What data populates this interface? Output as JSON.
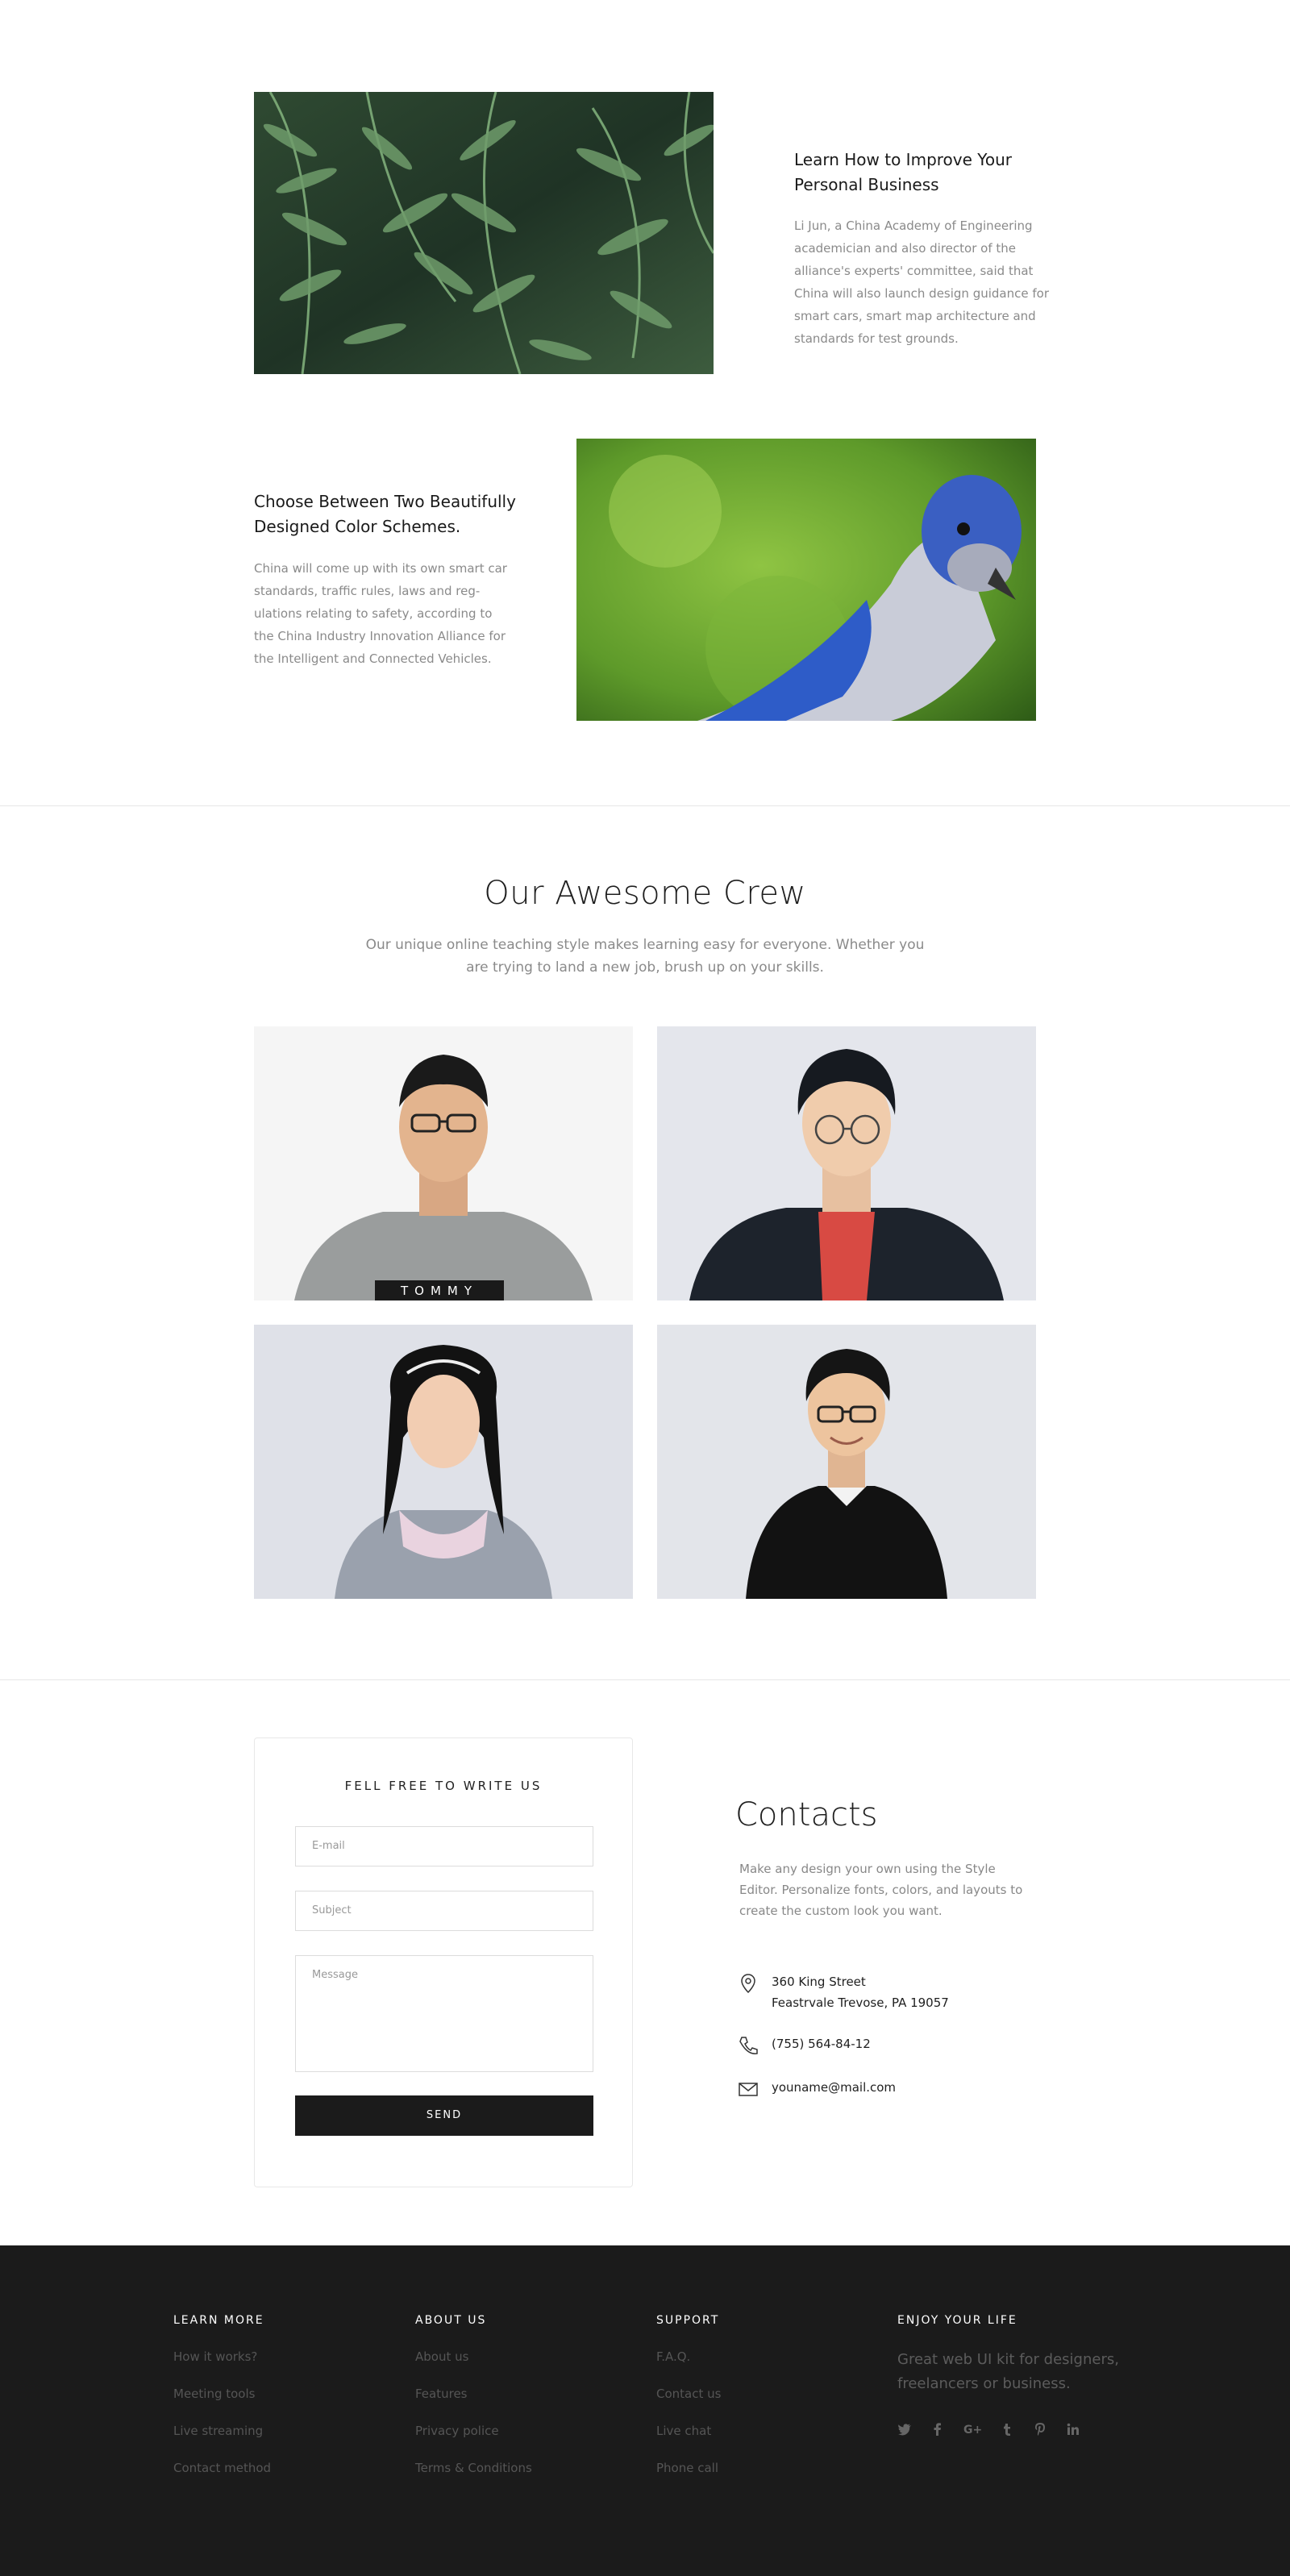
{
  "features": [
    {
      "title": "Learn How to Improve Your Personal Business",
      "text": "Li Jun, a China Academy of Engineering academician and also director of the alliance's experts' committee, said that China will also launch design guidance for smart cars, smart map architecture and standards for test grounds.",
      "image": "fern-leaves-photo"
    },
    {
      "title": "Choose Between Two Beautifully Designed Color Schemes.",
      "text": "China will come up with its own smart car standards, traffic rules, laws and reg-ulations relating to safety, according to the China Industry Innovation Alliance for the Intelligent and Connected Vehicles.",
      "image": "blue-bird-photo"
    }
  ],
  "crew": {
    "title": "Our Awesome Crew",
    "subtitle": "Our unique online teaching style makes learning easy for everyone. Whether you are trying to land a new job, brush up on your skills.",
    "members": [
      {
        "photo": "man-grey-sweater-photo",
        "shirt_text": "TOMMY"
      },
      {
        "photo": "man-black-jacket-photo"
      },
      {
        "photo": "woman-pink-sweater-photo"
      },
      {
        "photo": "man-black-sweater-photo"
      }
    ]
  },
  "form": {
    "title": "FELL FREE TO WRITE US",
    "email_placeholder": "E-mail",
    "subject_placeholder": "Subject",
    "message_placeholder": "Message",
    "send_label": "SEND"
  },
  "contacts": {
    "title": "Contacts",
    "text": "Make any design your own using the Style Editor. Personalize fonts, colors, and layouts to create the custom look you want.",
    "address_line1": "360 King Street",
    "address_line2": "Feastrvale Trevose, PA 19057",
    "phone": "(755) 564-84-12",
    "email": "youname@mail.com"
  },
  "footer": {
    "columns": [
      {
        "heading": "LEARN MORE",
        "links": [
          "How it works?",
          "Meeting tools",
          "Live streaming",
          "Contact method"
        ]
      },
      {
        "heading": "ABOUT US",
        "links": [
          "About us",
          "Features",
          "Privacy police",
          "Terms & Conditions"
        ]
      },
      {
        "heading": "SUPPORT",
        "links": [
          "F.A.Q.",
          "Contact us",
          "Live chat",
          "Phone call"
        ]
      }
    ],
    "enjoy": {
      "heading": "ENJOY YOUR LIFE",
      "text": "Great web UI kit for designers, freelancers or business.",
      "socials": [
        "twitter-icon",
        "facebook-icon",
        "google-plus-icon",
        "tumblr-icon",
        "pinterest-icon",
        "linkedin-icon"
      ]
    }
  },
  "colors": {
    "footer_bg": "#1b1b1b",
    "button_bg": "#1b1b1b",
    "text_muted": "#8a8a8a"
  }
}
